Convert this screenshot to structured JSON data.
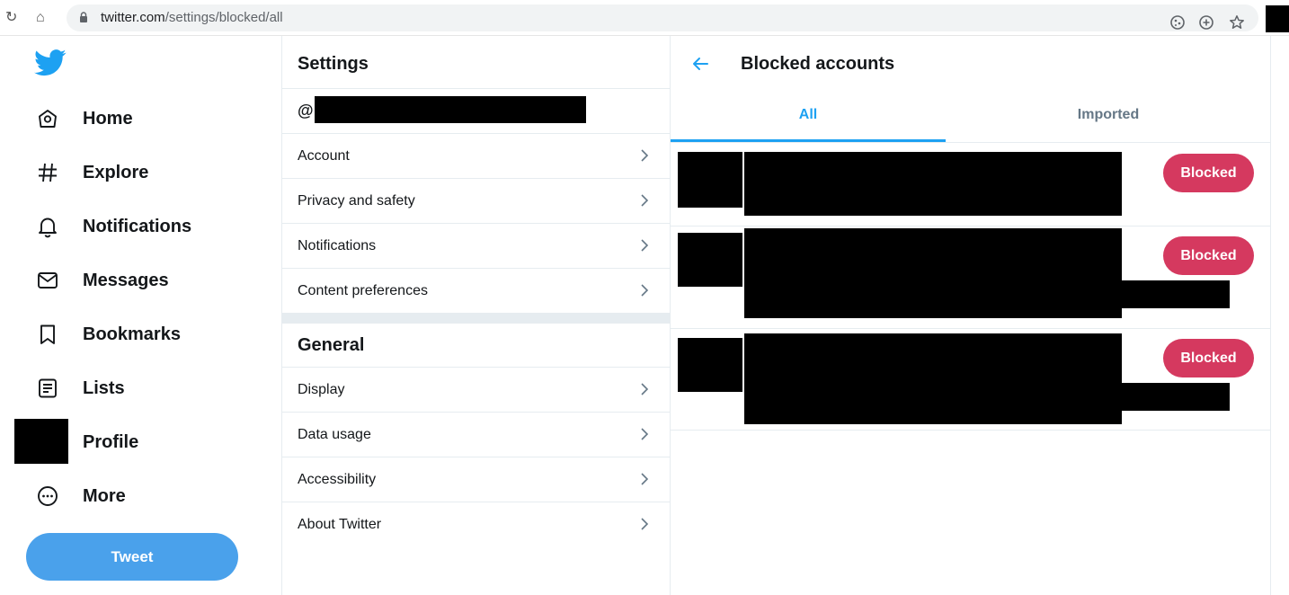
{
  "browser": {
    "url_host": "twitter.com",
    "url_path": "/settings/blocked/all",
    "reload_glyph": "↻",
    "home_glyph": "⌂"
  },
  "left_nav": {
    "logo_icon": "twitter-bird-icon",
    "items": [
      {
        "label": "Home",
        "icon": "home-icon"
      },
      {
        "label": "Explore",
        "icon": "hashtag-icon"
      },
      {
        "label": "Notifications",
        "icon": "bell-icon"
      },
      {
        "label": "Messages",
        "icon": "envelope-icon"
      },
      {
        "label": "Bookmarks",
        "icon": "bookmark-icon"
      },
      {
        "label": "Lists",
        "icon": "list-icon"
      },
      {
        "label": "Profile",
        "icon": "avatar"
      },
      {
        "label": "More",
        "icon": "more-icon"
      }
    ],
    "tweet_button": "Tweet"
  },
  "settings": {
    "title": "Settings",
    "handle_prefix": "@",
    "account_items": [
      {
        "label": "Account"
      },
      {
        "label": "Privacy and safety"
      },
      {
        "label": "Notifications"
      },
      {
        "label": "Content preferences"
      }
    ],
    "general_title": "General",
    "general_items": [
      {
        "label": "Display"
      },
      {
        "label": "Data usage"
      },
      {
        "label": "Accessibility"
      },
      {
        "label": "About Twitter"
      }
    ]
  },
  "blocked": {
    "title": "Blocked accounts",
    "tabs": [
      {
        "label": "All"
      },
      {
        "label": "Imported"
      }
    ],
    "accounts": [
      {
        "button": "Blocked"
      },
      {
        "button": "Blocked"
      },
      {
        "button": "Blocked"
      }
    ]
  },
  "colors": {
    "accent": "#1da1f2",
    "tweet_button": "#4aa1eb",
    "blocked_button": "#d5395f",
    "border": "#e6ecf0"
  }
}
